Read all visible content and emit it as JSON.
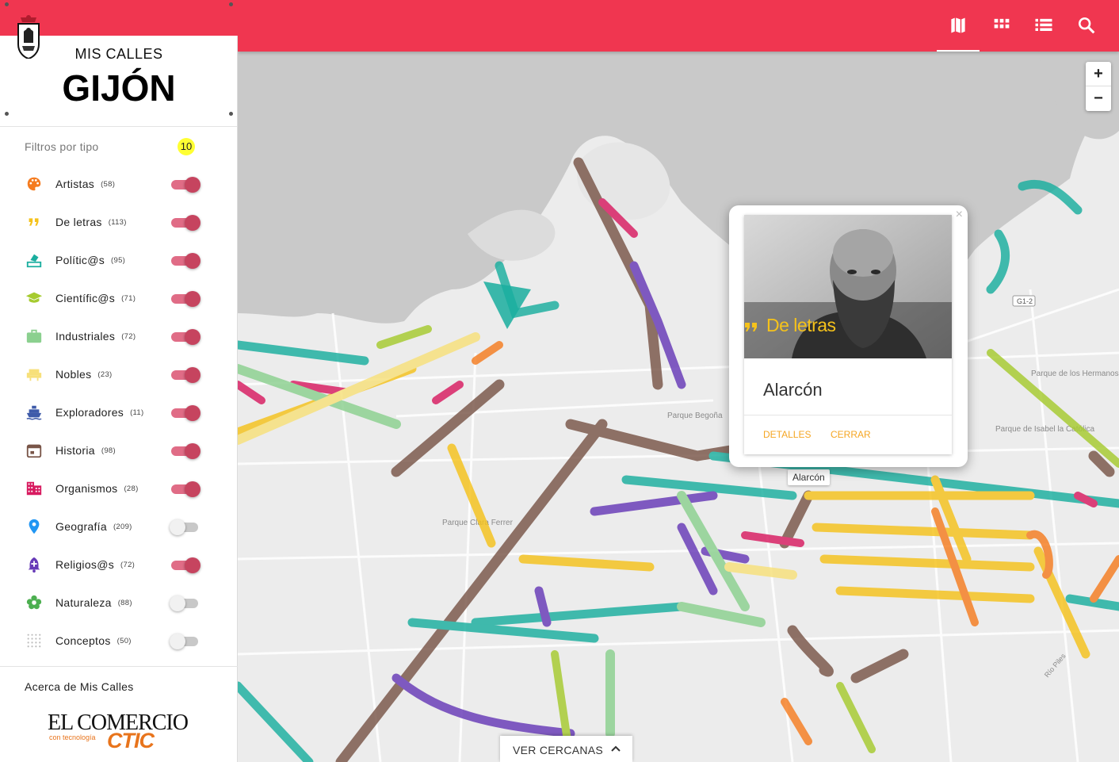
{
  "brand": {
    "small_title": "MIS CALLES",
    "big_title": "GIJÓN",
    "crest_icon": "city-crest-icon",
    "accent_color": "#f03650"
  },
  "filters": {
    "title": "Filtros por tipo",
    "active_count": "10",
    "items": [
      {
        "label": "Artistas",
        "count": "(58)",
        "icon": "palette-icon",
        "color": "#f57c20",
        "on": true
      },
      {
        "label": "De letras",
        "count": "(113)",
        "icon": "quote-icon",
        "color": "#f5c21b",
        "on": true
      },
      {
        "label": "Polític@s",
        "count": "(95)",
        "icon": "ballot-icon",
        "color": "#1aae9f",
        "on": true
      },
      {
        "label": "Científic@s",
        "count": "(71)",
        "icon": "graduation-cap-icon",
        "color": "#a6cb2f",
        "on": true
      },
      {
        "label": "Industriales",
        "count": "(72)",
        "icon": "briefcase-icon",
        "color": "#8bd08f",
        "on": true
      },
      {
        "label": "Nobles",
        "count": "(23)",
        "icon": "throne-icon",
        "color": "#f7e07a",
        "on": true
      },
      {
        "label": "Exploradores",
        "count": "(11)",
        "icon": "ship-icon",
        "color": "#3f5ba9",
        "on": true
      },
      {
        "label": "Historia",
        "count": "(98)",
        "icon": "calendar-icon",
        "color": "#795548",
        "on": true
      },
      {
        "label": "Organismos",
        "count": "(28)",
        "icon": "building-icon",
        "color": "#d81b60",
        "on": true
      },
      {
        "label": "Geografía",
        "count": "(209)",
        "icon": "map-pin-icon",
        "color": "#2196f3",
        "on": false
      },
      {
        "label": "Religios@s",
        "count": "(72)",
        "icon": "church-bell-icon",
        "color": "#673ab7",
        "on": true
      },
      {
        "label": "Naturaleza",
        "count": "(88)",
        "icon": "flower-icon",
        "color": "#4caf50",
        "on": false
      },
      {
        "label": "Conceptos",
        "count": "(50)",
        "icon": "dots-grid-icon",
        "color": "#bdbdbd",
        "on": false
      }
    ]
  },
  "about": {
    "link": "Acerca de Mis Calles",
    "logo_main": "EL COMERCIO",
    "logo_sub": "con tecnología",
    "logo_ctic": "CTIC"
  },
  "topbar": {
    "buttons": [
      {
        "name": "map-view-button",
        "icon": "map-icon"
      },
      {
        "name": "grid-view-button",
        "icon": "grid-icon"
      },
      {
        "name": "list-view-button",
        "icon": "list-icon"
      },
      {
        "name": "search-button",
        "icon": "search-icon"
      }
    ]
  },
  "map": {
    "zoom_in": "+",
    "zoom_out": "−",
    "labels": {
      "park1": "Parque de los Hermanos Castro",
      "park2": "Parque de Isabel la Católica",
      "park3": "Parque Begoña",
      "park4": "Parque Clara Ferrer",
      "road1": "G1-2",
      "road2": "Río Piles"
    },
    "street_tooltip": "Alarcón"
  },
  "popup": {
    "category": "De letras",
    "name": "Alarcón",
    "details_label": "DETALLES",
    "close_label": "CERRAR",
    "close_x": "×"
  },
  "nearby": {
    "label": "VER CERCANAS",
    "chevron": "^"
  }
}
